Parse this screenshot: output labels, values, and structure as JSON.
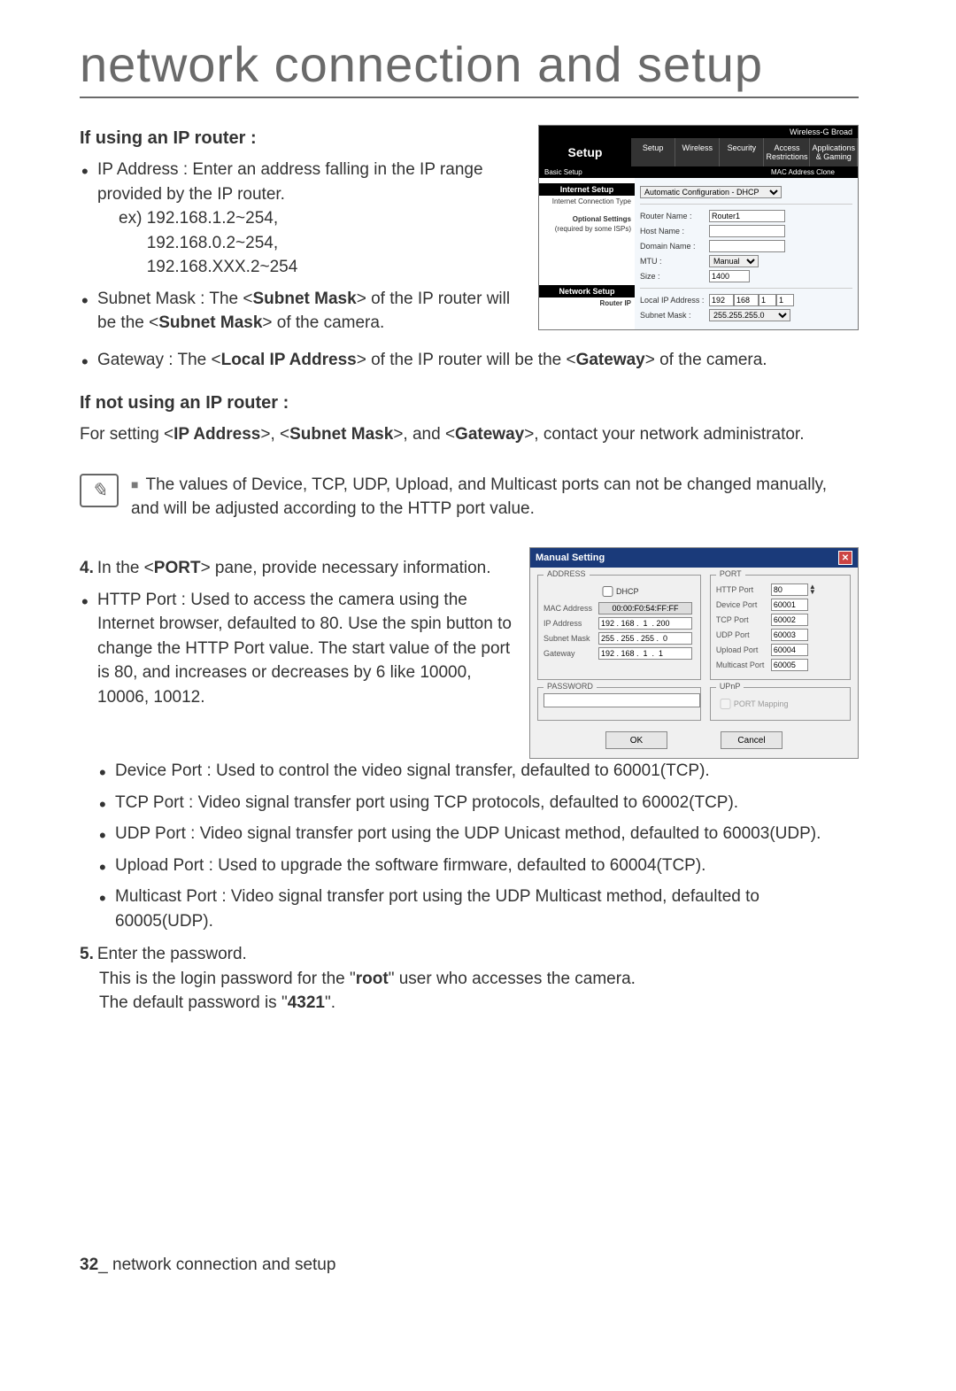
{
  "page_title": "network connection and setup",
  "section1": {
    "heading": "If using an IP router :",
    "items": {
      "ip_address_intro": "IP Address : Enter an address falling in the IP range provided by the IP router.",
      "ex_label": "ex)",
      "ex1": "192.168.1.2~254,",
      "ex2": "192.168.0.2~254,",
      "ex3": "192.168.XXX.2~254",
      "subnet_text_a": "Subnet Mask : The <",
      "subnet_bold1": "Subnet Mask",
      "subnet_text_b": "> of the IP router will be the <",
      "subnet_bold2": "Subnet Mask",
      "subnet_text_c": "> of the camera.",
      "gateway_text_a": "Gateway : The <",
      "gateway_bold1": "Local IP Address",
      "gateway_text_b": "> of the IP router will be the <",
      "gateway_bold2": "Gateway",
      "gateway_text_c": "> of the camera."
    }
  },
  "router": {
    "top_right": "Wireless-G Broad",
    "tab_main": "Setup",
    "tabs": [
      "Setup",
      "Wireless",
      "Security",
      "Access Restrictions",
      "Applications & Gaming"
    ],
    "subtab_left": "Basic Setup",
    "subtab_right": "MAC Address Clone",
    "side_internet_setup": "Internet Setup",
    "side_ict": "Internet Connection Type",
    "side_optional_a": "Optional Settings",
    "side_optional_b": "(required by some ISPs)",
    "side_network_setup": "Network Setup",
    "side_router_ip": "Router IP",
    "ict_value": "Automatic Configuration - DHCP",
    "router_name_lbl": "Router Name :",
    "router_name_val": "Router1",
    "host_name_lbl": "Host Name :",
    "domain_name_lbl": "Domain Name :",
    "mtu_lbl": "MTU :",
    "mtu_mode": "Manual",
    "size_lbl": "Size :",
    "size_val": "1400",
    "local_ip_lbl": "Local IP Address :",
    "local_ip_vals": [
      "192",
      "168",
      "1",
      "1"
    ],
    "subnet_mask_lbl": "Subnet Mask :",
    "subnet_mask_val": "255.255.255.0"
  },
  "section2": {
    "heading": "If not using an IP router :",
    "text_a": "For setting <",
    "b1": "IP Address",
    "text_b": ">, <",
    "b2": "Subnet Mask",
    "text_c": ">, and <",
    "b3": "Gateway",
    "text_d": ">, contact your network administrator."
  },
  "note": "The values of Device, TCP, UDP, Upload, and Multicast ports can not be changed manually, and will be adjusted according to the HTTP port value.",
  "section3": {
    "step4_num": "4.",
    "step4_a": "In the <",
    "step4_b": "PORT",
    "step4_c": "> pane, provide necessary information.",
    "bullets": {
      "http": "HTTP Port : Used to access the camera using the Internet browser, defaulted to 80. Use the spin button to change the HTTP Port value. The start value of the port is 80, and increases or decreases by 6 like 10000, 10006, 10012.",
      "device": "Device Port : Used to control the video signal transfer, defaulted to 60001(TCP).",
      "tcp": "TCP Port : Video signal transfer port using TCP protocols, defaulted to 60002(TCP).",
      "udp": "UDP Port : Video signal transfer port using the UDP Unicast method, defaulted to 60003(UDP).",
      "upload": "Upload Port : Used to upgrade the software firmware, defaulted to 60004(TCP).",
      "multicast": "Multicast Port : Video signal transfer port using the UDP Multicast method, defaulted to 60005(UDP)."
    },
    "step5_num": "5.",
    "step5_line1": "Enter the password.",
    "step5_line2a": "This is the login password for the \"",
    "step5_root": "root",
    "step5_line2b": "\" user who accesses the camera.",
    "step5_line3a": "The default password is \"",
    "step5_pw": "4321",
    "step5_line3b": "\"."
  },
  "dlg": {
    "title": "Manual Setting",
    "address_leg": "ADDRESS",
    "dhcp": "DHCP",
    "mac_lbl": "MAC Address",
    "mac_val": "00:00:F0:54:FF:FF",
    "ip_lbl": "IP Address",
    "ip_val": "192 . 168 .  1  . 200",
    "sn_lbl": "Subnet Mask",
    "sn_val": "255 . 255 . 255 .  0 ",
    "gw_lbl": "Gateway",
    "gw_val": "192 . 168 .  1  .  1 ",
    "port_leg": "PORT",
    "http_port_lbl": "HTTP Port",
    "http_port_val": "80",
    "device_port_lbl": "Device Port",
    "device_port_val": "60001",
    "tcp_port_lbl": "TCP Port",
    "tcp_port_val": "60002",
    "udp_port_lbl": "UDP Port",
    "udp_port_val": "60003",
    "upload_port_lbl": "Upload Port",
    "upload_port_val": "60004",
    "multicast_port_lbl": "Multicast Port",
    "multicast_port_val": "60005",
    "password_leg": "PASSWORD",
    "upnp_leg": "UPnP",
    "port_mapping": "PORT Mapping",
    "ok": "OK",
    "cancel": "Cancel"
  },
  "footer": {
    "page_num": "32",
    "sep": "_",
    "text": " network connection and setup"
  }
}
